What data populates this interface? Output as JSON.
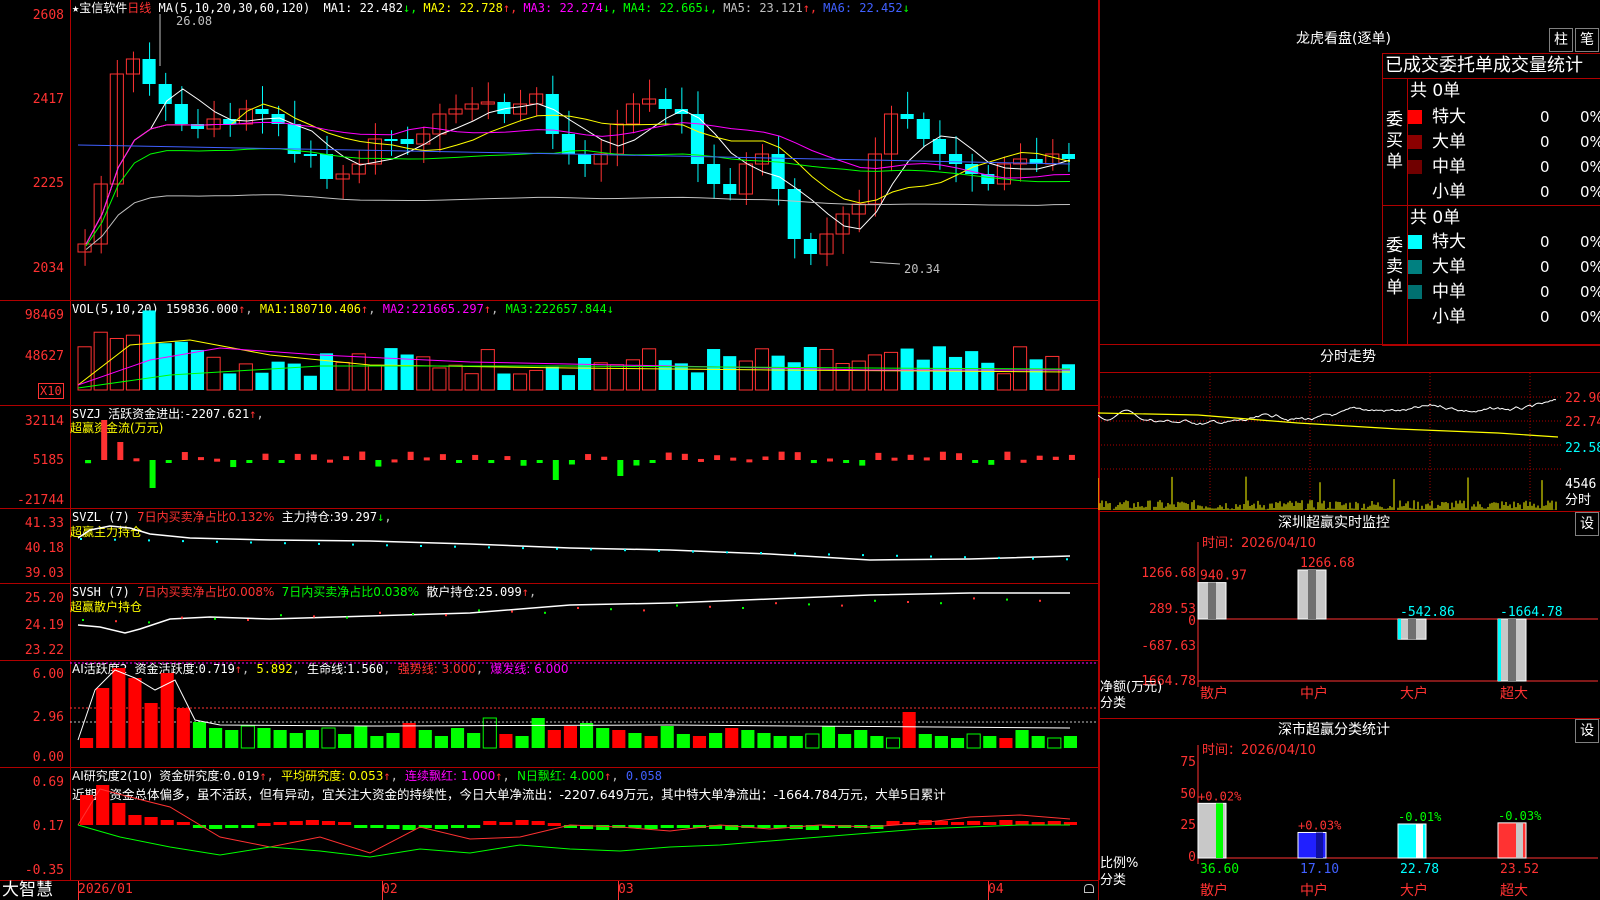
{
  "app": {
    "name": "宝信软件",
    "period": "日线",
    "footer_logo": "大智慧"
  },
  "main": {
    "ma_header": "MA(5,10,20,30,60,120)",
    "ma_values": [
      {
        "label": "MA1:",
        "value": "22.482",
        "arrow": "↓",
        "color": "#ffffff"
      },
      {
        "label": "MA2:",
        "value": "22.728",
        "arrow": "↑",
        "color": "#ffff00"
      },
      {
        "label": "MA3:",
        "value": "22.274",
        "arrow": "↓",
        "color": "#ff00ff"
      },
      {
        "label": "MA4:",
        "value": "22.665",
        "arrow": "↓",
        "color": "#00ff00"
      },
      {
        "label": "MA5:",
        "value": "23.121",
        "arrow": "↑",
        "color": "#c0c0c0"
      },
      {
        "label": "MA6:",
        "value": "22.452",
        "arrow": "↓",
        "color": "#4060ff"
      }
    ],
    "y_ticks": [
      "2608",
      "2417",
      "2225",
      "2034"
    ],
    "high_label": "26.08",
    "low_label": "20.34"
  },
  "vol": {
    "header": "VOL(5,10,20)",
    "value": "159836.000",
    "ma": [
      {
        "label": "MA1:",
        "value": "180710.406",
        "arrow": "↑"
      },
      {
        "label": "MA2:",
        "value": "221665.297",
        "arrow": "↑"
      },
      {
        "label": "MA3:",
        "value": "222657.844",
        "arrow": "↓"
      }
    ],
    "y_ticks": [
      "98469",
      "48627"
    ],
    "unit": "X10"
  },
  "svzj": {
    "header": "SVZJ",
    "label": "活跃资金进出:",
    "value": "-2207.621",
    "arrow": "↑",
    "sub": "超赢资金流(万元)",
    "y_ticks": [
      "32114",
      "5185",
      "-21744"
    ]
  },
  "svzl": {
    "header": "SVZL (7)",
    "ratio": "7日内买卖净占比0.132%",
    "hold_label": "主力持仓:",
    "hold": "39.297",
    "arrow": "↓",
    "sub": "超赢主力持仓",
    "y_ticks": [
      "41.33",
      "40.18",
      "39.03"
    ]
  },
  "svsh": {
    "header": "SVSH (7)",
    "ratio1": "7日内买卖净占比0.008%",
    "ratio2": "7日内买卖净占比0.038%",
    "hold_label": "散户持仓:",
    "hold": "25.099",
    "arrow": "↑",
    "sub": "超赢散户持仓",
    "y_ticks": [
      "25.20",
      "24.19",
      "23.22"
    ]
  },
  "ai_active": {
    "header": "AI活跃度2",
    "label": "资金活跃度:",
    "value": "0.719",
    "v2": "5.892",
    "life_label": "生命线:",
    "life": "1.560",
    "strong": "强势线: 3.000",
    "burst": "爆发线: 6.000",
    "y_ticks": [
      "6.00",
      "2.96",
      "0.00"
    ]
  },
  "ai_research": {
    "header": "AI研究度2(10)",
    "label": "资金研究度:",
    "value": "0.019",
    "avg": "平均研究度: 0.053",
    "cont": "连续飘红: 1.000",
    "nred": "N日飘红: 4.000",
    "last": "0.058",
    "comment": "近期大资金总体偏多，虽不活跃，但有异动，宜关注大资金的持续性，今日大单净流出：-2207.649万元，其中特大单净流出：-1664.784万元，大单5日累计",
    "y_ticks": [
      "0.69",
      "0.17",
      "-0.35"
    ]
  },
  "x_axis": [
    "2026/01",
    "02",
    "03",
    "04"
  ],
  "right": {
    "lhb_title": "龙虎看盘(逐单)",
    "btn_zhu": "柱",
    "btn_bi": "笔",
    "stats_title": "已成交委托单成交量统计",
    "buy_label": "委买单",
    "sell_label": "委卖单",
    "buy_total": "共 0单",
    "sell_total": "共 0单",
    "rows": [
      "特大",
      "大单",
      "中单",
      "小单"
    ],
    "zero": "0",
    "pct": "0%",
    "fs_title": "分时走势",
    "fs_y": [
      "22.90",
      "22.74",
      "22.58",
      "4546",
      "分时"
    ],
    "monitor_title": "深圳超赢实时监控",
    "monitor_time": "时间：2026/04/10",
    "monitor_set": "设",
    "monitor_y": [
      "1266.68",
      "289.53",
      "0",
      "-687.63",
      "-1664.78"
    ],
    "monitor_unit": "净额(万元)",
    "monitor_cat": "分类",
    "monitor_bars": [
      {
        "name": "散户",
        "value": 940.97
      },
      {
        "name": "中户",
        "value": 1266.68
      },
      {
        "name": "大户",
        "value": -542.86
      },
      {
        "name": "超大",
        "value": -1664.78
      }
    ],
    "class_title": "深市超赢分类统计",
    "class_time": "时间：2026/04/10",
    "class_set": "设",
    "class_y": [
      "75",
      "50",
      "25",
      "0"
    ],
    "class_unit": "比例%",
    "class_cat": "分类",
    "class_bars": [
      {
        "name": "散户",
        "value": 36.6,
        "change": "+0.02%"
      },
      {
        "name": "中户",
        "value": 17.1,
        "change": "+0.03%"
      },
      {
        "name": "大户",
        "value": 22.78,
        "change": "-0.01%"
      },
      {
        "name": "超大",
        "value": 23.52,
        "change": "-0.03%"
      }
    ]
  }
}
